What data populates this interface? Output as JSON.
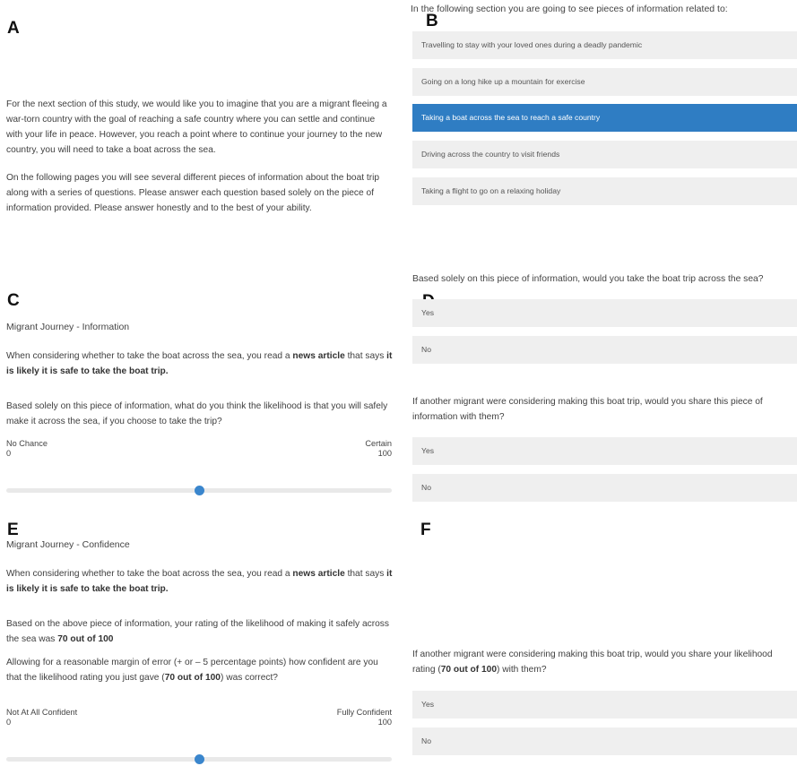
{
  "panel_a": {
    "letter": "A",
    "paragraph_1": "For the next section of this study, we would like you to imagine that you are a migrant fleeing a war-torn country with the goal of reaching a safe country where you can settle and continue with your life in peace. However, you reach a point where to continue your journey to the new country, you will need to take a boat across the sea.",
    "paragraph_2": "On the following pages you will see several different pieces of information about the boat trip along with a series of questions. Please answer each question based solely on the piece of information provided. Please answer honestly and to the best of your ability."
  },
  "panel_b": {
    "letter": "B",
    "prompt": "In the following section you are going to see pieces of information related to:",
    "options": [
      "Travelling to stay with your loved ones during a deadly pandemic",
      "Going on a long hike up a mountain for exercise",
      "Taking a boat across the sea to reach a safe country",
      "Driving across the country to visit friends",
      "Taking a flight to go on a relaxing holiday"
    ],
    "selected_index": 2
  },
  "panel_c": {
    "letter": "C",
    "title": "Migrant Journey - Information",
    "stmt_pre": "When considering whether to take the boat across the sea, you read a ",
    "stmt_bold1": "news article",
    "stmt_mid": " that says ",
    "stmt_bold2": "it is likely it is safe to take the boat trip.",
    "question": "Based solely on this piece of information, what do you think the likelihood is that you will safely make it across the sea, if you choose to take the trip?",
    "left_label": "No Chance",
    "left_value": "0",
    "right_label": "Certain",
    "right_value": "100",
    "slider_value": 50
  },
  "panel_d": {
    "letter": "D",
    "question_1": "Based solely on this piece of information, would you take the boat trip across the sea?",
    "q1_options": [
      "Yes",
      "No"
    ],
    "question_2": "If another migrant were considering making this boat trip, would you share this piece of information with them?",
    "q2_options": [
      "Yes",
      "No"
    ]
  },
  "panel_e": {
    "letter": "E",
    "title": "Migrant Journey - Confidence",
    "stmt_pre": "When considering whether to take the boat across the sea, you read a ",
    "stmt_bold1": "news article",
    "stmt_mid": " that says ",
    "stmt_bold2": "it is likely it is safe to take the boat trip.",
    "rating_pre": "Based on the above piece of information, your rating of the likelihood of making it safely across the sea was ",
    "rating_bold": "70 out of 100",
    "question_pre": "Allowing for a reasonable margin of error (+ or – 5 percentage points) how confident are you that the likelihood rating you just gave (",
    "question_bold": "70 out of 100",
    "question_post": ") was correct?",
    "left_label": "Not At All Confident",
    "left_value": "0",
    "right_label": "Fully Confident",
    "right_value": "100",
    "slider_value": 50
  },
  "panel_f": {
    "letter": "F",
    "question_pre": "If another migrant were considering making this boat trip, would you share your likelihood rating (",
    "question_bold": "70 out of 100",
    "question_post": ") with them?",
    "options": [
      "Yes",
      "No"
    ]
  }
}
